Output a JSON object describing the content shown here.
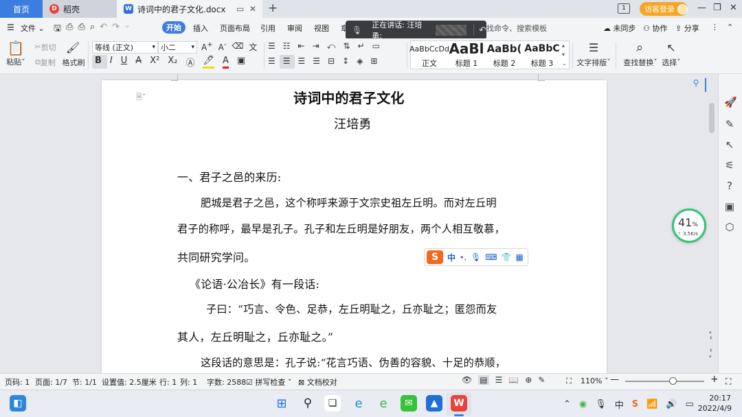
{
  "window": {
    "tabs": {
      "home": "首页",
      "daoke": "稻壳",
      "doc": "诗词中的君子文化.docx"
    },
    "login_label": "访客登录",
    "badge_num": "1"
  },
  "menubar": {
    "file": "文件",
    "items": [
      "开始",
      "插入",
      "页面布局",
      "引用",
      "审阅",
      "视图",
      "章"
    ],
    "search_placeholder": "找命令、搜索模板",
    "right": {
      "sync": "未同步",
      "collab": "协作",
      "share": "分享"
    }
  },
  "voice": {
    "speaking_label": "正在讲话: 汪培勇;"
  },
  "ribbon": {
    "paste": "粘贴",
    "cut": "剪切",
    "copy": "复制",
    "format_painter": "格式刷",
    "font_name": "等线 (正文)",
    "font_size": "小二",
    "styles": [
      {
        "preview": "AaBbCcDd",
        "name": "正文"
      },
      {
        "preview": "AaBl",
        "name": "标题 1"
      },
      {
        "preview": "AaBb(",
        "name": "标题 2"
      },
      {
        "preview": "AaBbC",
        "name": "标题 3"
      }
    ],
    "text_layout": "文字排版",
    "find_replace": "查找替换",
    "select": "选择"
  },
  "document": {
    "title": "诗词中的君子文化",
    "author": "汪培勇",
    "lines": [
      "一、君子之邑的来历:",
      "肥城是君子之邑，这个称呼来源于文宗史祖左丘明。而对左丘明",
      "君子的称呼，最早是孔子。孔子和左丘明是好朋友，两个人相互敬慕，",
      "共同研究学问。",
      "《论语·公冶长》有一段话:",
      "子曰：“巧言、令色、足恭，左丘明耻之，丘亦耻之；匿怨而友",
      "其人，左丘明耻之，丘亦耻之。”",
      "这段话的意思是：孔子说:“花言巧语、伪善的容貌、十足的恭顺，"
    ]
  },
  "speed_widget": {
    "percent": "41",
    "percent_sign": "%",
    "rate": "3.5K/s"
  },
  "ime": {
    "lang": "中",
    "punct": "•,"
  },
  "status": {
    "page_num": "页码: 1",
    "pages": "页面: 1/7",
    "section": "节: 1/1",
    "setting": "设置值: 2.5厘米",
    "row": "行: 1",
    "col": "列: 1",
    "words": "字数: 2588",
    "spell": "拼写检查",
    "proof": "文档校对",
    "zoom": "110%",
    "zoom_fraction": 0.6
  },
  "taskbar": {
    "time": "20:17",
    "date": "2022/4/9"
  }
}
